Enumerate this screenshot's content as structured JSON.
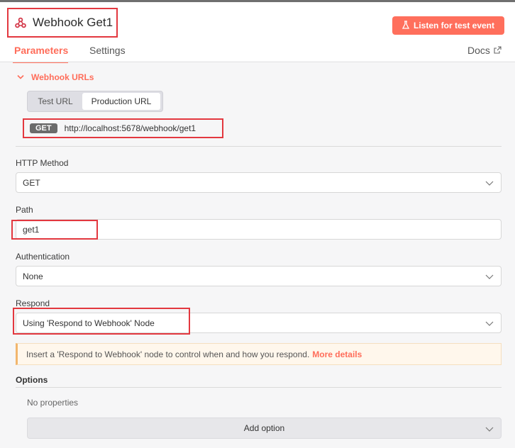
{
  "header": {
    "title": "Webhook Get1",
    "listen_button": "Listen for test event"
  },
  "tabs": {
    "parameters": "Parameters",
    "settings": "Settings",
    "docs": "Docs"
  },
  "webhook_urls": {
    "section_label": "Webhook URLs",
    "test_url": "Test URL",
    "production_url": "Production URL",
    "method_badge": "GET",
    "url": "http://localhost:5678/webhook/get1"
  },
  "form": {
    "http_method_label": "HTTP Method",
    "http_method_value": "GET",
    "path_label": "Path",
    "path_value": "get1",
    "authentication_label": "Authentication",
    "authentication_value": "None",
    "respond_label": "Respond",
    "respond_value": "Using 'Respond to Webhook' Node"
  },
  "notice": {
    "text": "Insert a 'Respond to Webhook' node to control when and how you respond.",
    "link": "More details"
  },
  "options": {
    "label": "Options",
    "empty_text": "No properties",
    "add_button": "Add option"
  },
  "colors": {
    "accent": "#ff6d5a",
    "highlight_box": "#e3383f"
  }
}
